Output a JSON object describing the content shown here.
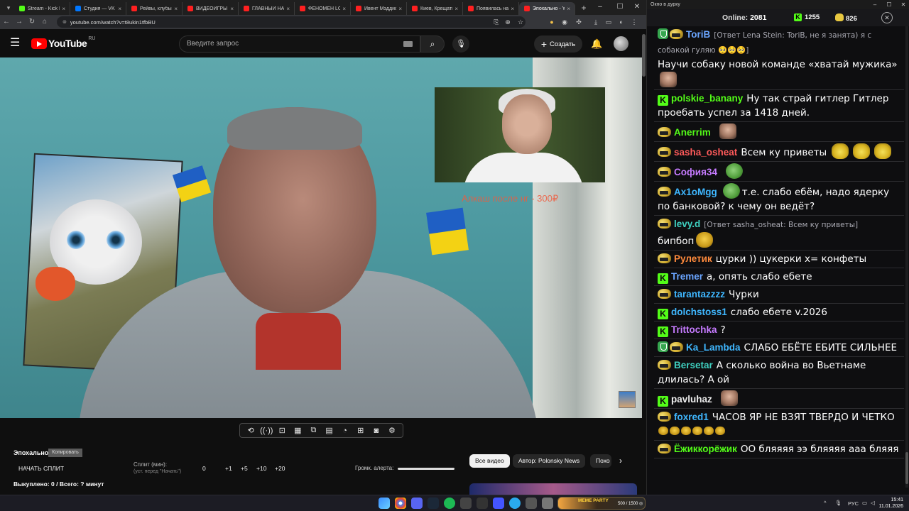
{
  "browser": {
    "tabs": [
      {
        "title": "Stream - Kick Di",
        "fav": "kick"
      },
      {
        "title": "Студия — VK B",
        "fav": "vk"
      },
      {
        "title": "Рейвы, клубы, ",
        "fav": "yt"
      },
      {
        "title": "ВИДЕОИГРЫ д",
        "fav": "yt"
      },
      {
        "title": "ГЛАВНЫЙ НАР",
        "fav": "yt"
      },
      {
        "title": "ФЕНОМЕН LOC",
        "fav": "yt"
      },
      {
        "title": "Ивент Мэддис",
        "fav": "yt"
      },
      {
        "title": "Киев, Крещаты",
        "fav": "yt"
      },
      {
        "title": "Появилась над",
        "fav": "yt"
      },
      {
        "title": "Эпохально - Yo",
        "fav": "yt",
        "active": true
      }
    ],
    "url": "youtube.com/watch?v=t8ukin1tfbBU"
  },
  "youtube": {
    "logo_text": "YouTube",
    "region": "RU",
    "search_placeholder": "Введите запрос",
    "create_label": "Создать"
  },
  "video": {
    "overlay_text": "Алкаш после нг - 300₽"
  },
  "below": {
    "epoch_label": "Эпохально",
    "copy_label": "Копировать",
    "start_split": "НАЧАТЬ СПЛИТ",
    "split_label": "Сплит (мин):",
    "split_hint": "(уст. перед \"Начать\")",
    "split_value": "0",
    "steps": [
      "+1",
      "+5",
      "+10",
      "+20"
    ],
    "volume_label": "Громк. алерта:",
    "bought": "Выкуплено: 0 / Всего: ? минут",
    "chips": [
      "Все видео",
      "Автор: Polonsky News",
      "Похо"
    ]
  },
  "chat": {
    "window_title": "Окно в дурку",
    "online_label": "Online:",
    "online_count": "2081",
    "kick_count": "1255",
    "coin_count": "826",
    "messages": [
      {
        "badge": "shield+pepe",
        "user": "ToriB",
        "color": "#6aa5ff",
        "reply": "[Ответ Lena Stein: ToriB, не я занята) я с собакой гуляю 🥺🥺🥺]",
        "text": "Научи собаку новой команде «хватай мужика»",
        "emote": "face"
      },
      {
        "badge": "kick",
        "user": "polskie_banany",
        "color": "#53fc18",
        "text": "Ну так страй гитлер Гитлер проебать успел за 1418 дней."
      },
      {
        "badge": "pepe",
        "user": "Anerrim",
        "color": "#53fc18",
        "text": "",
        "emote": "face"
      },
      {
        "badge": "pepe",
        "user": "sasha_osheat",
        "color": "#ff5a5a",
        "text": "Всем ку приветы",
        "emote": "wave3"
      },
      {
        "badge": "pepe",
        "user": "София34",
        "color": "#c67bff",
        "text": "",
        "emote": "pepe"
      },
      {
        "badge": "pepe",
        "user": "Ax1oMgg",
        "color": "#3fb7ff",
        "text": "т.е. слабо ебём, надо ядерку по банковой? к чему он ведёт?",
        "emote_before": "pepe"
      },
      {
        "badge": "pepe",
        "user": "levy.d",
        "color": "#3fd0c0",
        "reply": "[Ответ sasha_osheat: Всем ку приветы]",
        "text": "бипбоп",
        "emote": "gold"
      },
      {
        "badge": "pepe",
        "user": "Рулетик",
        "color": "#ff8a3c",
        "text": "цурки )) цукерки х= конфеты"
      },
      {
        "badge": "kick",
        "user": "Tremer",
        "color": "#6aa5ff",
        "text": "а, опять слабо ебете"
      },
      {
        "badge": "pepe",
        "user": "tarantazzzz",
        "color": "#3fb7ff",
        "text": "Чурки"
      },
      {
        "badge": "kick",
        "user": "dolchstoss1",
        "color": "#3fb7ff",
        "text": "слабо ебете v.2026"
      },
      {
        "badge": "kick",
        "user": "Trittochka",
        "color": "#c67bff",
        "text": "?"
      },
      {
        "badge": "shield+pepe",
        "user": "Ka_Lambda",
        "color": "#3fb7ff",
        "text": "СЛАБО ЕБЁТЕ ЕБИТЕ СИЛЬНЕЕ"
      },
      {
        "badge": "pepe",
        "user": "Bersetar",
        "color": "#3fd0c0",
        "text": "А сколько война во Вьетнаме длилась? А ой"
      },
      {
        "badge": "kick",
        "user": "pavluhaz",
        "color": "#eeeeee",
        "text": "",
        "emote": "face"
      },
      {
        "badge": "pepe",
        "user": "foxred1",
        "color": "#3fb7ff",
        "text": "ЧАСОВ ЯР НЕ ВЗЯТ ТВЕРДО И ЧЕТКО",
        "emote_row": true
      },
      {
        "badge": "pepe",
        "user": "Ёжиккорёжик",
        "color": "#53fc18",
        "text": "ОО бляяяя ээ бляяяя ааа бляяя"
      }
    ]
  },
  "taskbar": {
    "meme_party": "MEME PARTY",
    "meme_count": "500 / 1500 ◎",
    "lang": "РУС",
    "time": "15:41",
    "date": "11.01.2026"
  }
}
